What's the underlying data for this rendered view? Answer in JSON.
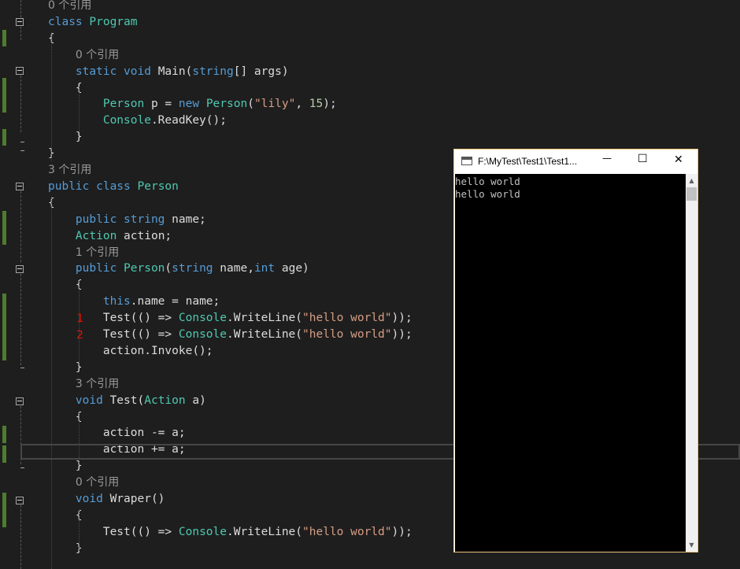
{
  "code_lines": [
    [
      {
        "c": "lens",
        "t": "0 个引用"
      }
    ],
    [
      {
        "c": "k",
        "t": "class "
      },
      {
        "c": "t",
        "t": "Program"
      }
    ],
    [
      {
        "c": "p",
        "t": "{"
      }
    ],
    [
      {
        "c": "p",
        "t": "    "
      },
      {
        "c": "lens",
        "t": "0 个引用"
      }
    ],
    [
      {
        "c": "p",
        "t": "    "
      },
      {
        "c": "k",
        "t": "static void "
      },
      {
        "c": "p",
        "t": "Main("
      },
      {
        "c": "k",
        "t": "string"
      },
      {
        "c": "p",
        "t": "[] args)"
      }
    ],
    [
      {
        "c": "p",
        "t": "    {"
      }
    ],
    [
      {
        "c": "p",
        "t": "        "
      },
      {
        "c": "t",
        "t": "Person"
      },
      {
        "c": "p",
        "t": " p = "
      },
      {
        "c": "k",
        "t": "new "
      },
      {
        "c": "t",
        "t": "Person"
      },
      {
        "c": "p",
        "t": "("
      },
      {
        "c": "s",
        "t": "\"lily\""
      },
      {
        "c": "p",
        "t": ", "
      },
      {
        "c": "n",
        "t": "15"
      },
      {
        "c": "p",
        "t": ");"
      }
    ],
    [
      {
        "c": "p",
        "t": "        "
      },
      {
        "c": "t",
        "t": "Console"
      },
      {
        "c": "p",
        "t": ".ReadKey();"
      }
    ],
    [
      {
        "c": "p",
        "t": "    }"
      }
    ],
    [
      {
        "c": "p",
        "t": "}"
      }
    ],
    [
      {
        "c": "lens",
        "t": "3 个引用"
      }
    ],
    [
      {
        "c": "k",
        "t": "public class "
      },
      {
        "c": "t",
        "t": "Person"
      }
    ],
    [
      {
        "c": "p",
        "t": "{"
      }
    ],
    [
      {
        "c": "p",
        "t": "    "
      },
      {
        "c": "k",
        "t": "public string "
      },
      {
        "c": "p",
        "t": "name;"
      }
    ],
    [
      {
        "c": "p",
        "t": "    "
      },
      {
        "c": "t",
        "t": "Action"
      },
      {
        "c": "p",
        "t": " action;"
      }
    ],
    [
      {
        "c": "p",
        "t": "    "
      },
      {
        "c": "lens",
        "t": "1 个引用"
      }
    ],
    [
      {
        "c": "p",
        "t": "    "
      },
      {
        "c": "k",
        "t": "public "
      },
      {
        "c": "t",
        "t": "Person"
      },
      {
        "c": "p",
        "t": "("
      },
      {
        "c": "k",
        "t": "string"
      },
      {
        "c": "p",
        "t": " name,"
      },
      {
        "c": "k",
        "t": "int"
      },
      {
        "c": "p",
        "t": " age)"
      }
    ],
    [
      {
        "c": "p",
        "t": "    {"
      }
    ],
    [
      {
        "c": "p",
        "t": "        "
      },
      {
        "c": "k",
        "t": "this"
      },
      {
        "c": "p",
        "t": ".name = name;"
      }
    ],
    [
      {
        "c": "p",
        "t": "        Test(() => "
      },
      {
        "c": "t",
        "t": "Console"
      },
      {
        "c": "p",
        "t": ".WriteLine("
      },
      {
        "c": "s",
        "t": "\"hello world\""
      },
      {
        "c": "p",
        "t": "));"
      }
    ],
    [
      {
        "c": "p",
        "t": "        Test(() => "
      },
      {
        "c": "t",
        "t": "Console"
      },
      {
        "c": "p",
        "t": ".WriteLine("
      },
      {
        "c": "s",
        "t": "\"hello world\""
      },
      {
        "c": "p",
        "t": "));"
      }
    ],
    [
      {
        "c": "p",
        "t": "        action.Invoke();"
      }
    ],
    [
      {
        "c": "p",
        "t": "    }"
      }
    ],
    [
      {
        "c": "p",
        "t": "    "
      },
      {
        "c": "lens",
        "t": "3 个引用"
      }
    ],
    [
      {
        "c": "p",
        "t": "    "
      },
      {
        "c": "k",
        "t": "void "
      },
      {
        "c": "p",
        "t": "Test("
      },
      {
        "c": "t",
        "t": "Action"
      },
      {
        "c": "p",
        "t": " a)"
      }
    ],
    [
      {
        "c": "p",
        "t": "    {"
      }
    ],
    [
      {
        "c": "p",
        "t": "        action -= a;"
      }
    ],
    [
      {
        "c": "p",
        "t": "        action += a;"
      }
    ],
    [
      {
        "c": "p",
        "t": "    }"
      }
    ],
    [
      {
        "c": "p",
        "t": "    "
      },
      {
        "c": "lens",
        "t": "0 个引用"
      }
    ],
    [
      {
        "c": "p",
        "t": "    "
      },
      {
        "c": "k",
        "t": "void "
      },
      {
        "c": "p",
        "t": "Wraper()"
      }
    ],
    [
      {
        "c": "p",
        "t": "    {"
      }
    ],
    [
      {
        "c": "p",
        "t": "        Test(() => "
      },
      {
        "c": "t",
        "t": "Console"
      },
      {
        "c": "p",
        "t": ".WriteLine("
      },
      {
        "c": "s",
        "t": "\"hello world\""
      },
      {
        "c": "p",
        "t": "));"
      }
    ],
    [
      {
        "c": "p",
        "t": "    }"
      }
    ]
  ],
  "line_markers": [
    "1",
    "2"
  ],
  "console": {
    "title": "F:\\MyTest\\Test1\\Test1...",
    "minimize_glyph": "—",
    "maximize_glyph": "☐",
    "close_glyph": "✕",
    "output": [
      "hello world",
      "hello world"
    ],
    "scroll_up": "▲",
    "scroll_down": "▼"
  },
  "colors": {
    "keyword": "#569cd6",
    "type": "#4ec9b0",
    "string": "#d69d85",
    "marker": "#e51400",
    "change_bar": "#4e7c2e"
  }
}
